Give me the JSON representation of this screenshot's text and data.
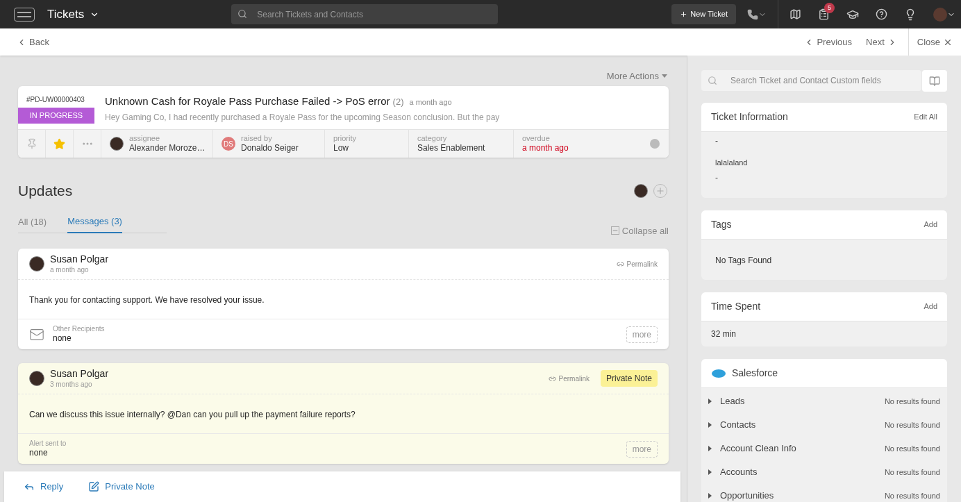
{
  "topbar": {
    "title": "Tickets",
    "search_placeholder": "Search Tickets and Contacts",
    "new_ticket": "New Ticket",
    "notification_count": "5"
  },
  "subbar": {
    "back": "Back",
    "previous": "Previous",
    "next": "Next",
    "close": "Close"
  },
  "more_actions": "More Actions",
  "ticket": {
    "id": "#PD-UW00000403",
    "status": "IN PROGRESS",
    "subject": "Unknown Cash for Royale Pass Purchase Failed -> PoS error",
    "count": "(2)",
    "time": "a month ago",
    "preview": "Hey Gaming Co, I had recently purchased a Royale Pass for the upcoming Season conclusion. But the pay",
    "pinned": false,
    "starred": true,
    "fields": [
      {
        "kind": "person",
        "label": "assignee",
        "value": "Alexander Moroze…",
        "alert": false
      },
      {
        "kind": "initials",
        "initials": "DS",
        "label": "raised by",
        "value": "Donaldo Seiger",
        "alert": false
      },
      {
        "kind": "plain",
        "label": "priority",
        "value": "Low",
        "alert": false
      },
      {
        "kind": "plain",
        "label": "category",
        "value": "Sales Enablement",
        "alert": false
      },
      {
        "kind": "plain",
        "label": "overdue",
        "value": "a month ago",
        "alert": true
      }
    ]
  },
  "updates": {
    "title": "Updates",
    "collapse_all": "Collapse all",
    "tabs": [
      {
        "label": "All (18)",
        "selected": false
      },
      {
        "label": "Messages (3)",
        "selected": true
      }
    ],
    "messages": [
      {
        "kind": "email",
        "author": "Susan Polgar",
        "time": "a month ago",
        "permalink": "Permalink",
        "body": "Thank you for contacting support. We have resolved your issue.",
        "footer_label": "Other Recipients",
        "footer_value": "none",
        "more": "more"
      },
      {
        "kind": "private",
        "author": "Susan Polgar",
        "time": "3 months ago",
        "permalink": "Permalink",
        "badge": "Private Note",
        "body": "Can we discuss this issue internally? @Dan can you pull up the payment failure reports?",
        "footer_label": "Alert sent to",
        "footer_value": "none",
        "more": "more"
      }
    ]
  },
  "reply_bar": {
    "reply": "Reply",
    "private_note": "Private Note"
  },
  "sidebar": {
    "search_placeholder": "Search Ticket and Contact Custom fields",
    "ticket_information": {
      "title": "Ticket Information",
      "action": "Edit All",
      "fields": [
        {
          "value": "-"
        },
        {
          "label": "lalalaland",
          "value": "-"
        }
      ]
    },
    "tags": {
      "title": "Tags",
      "action": "Add",
      "empty": "No Tags Found"
    },
    "time_spent": {
      "title": "Time Spent",
      "action": "Add",
      "value": "32 min"
    },
    "salesforce": {
      "title": "Salesforce",
      "items": [
        {
          "label": "Leads",
          "status": "No results found"
        },
        {
          "label": "Contacts",
          "status": "No results found"
        },
        {
          "label": "Account Clean Info",
          "status": "No results found"
        },
        {
          "label": "Accounts",
          "status": "No results found"
        },
        {
          "label": "Opportunities",
          "status": "No results found"
        }
      ]
    }
  }
}
